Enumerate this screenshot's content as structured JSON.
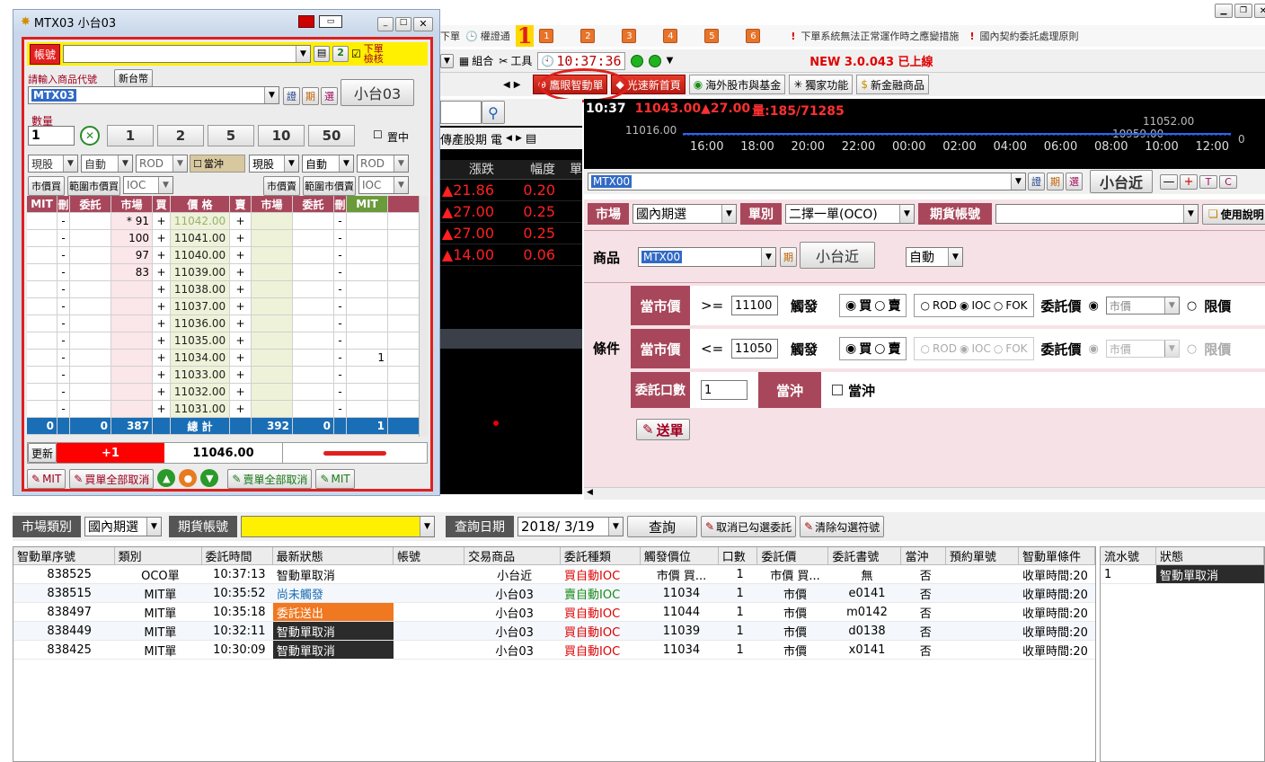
{
  "topbar": {
    "text1": "下單",
    "text2": "權證通",
    "marker": "1",
    "nums": [
      "1",
      "2",
      "3",
      "4",
      "5",
      "6"
    ],
    "notice1": "下單系統無法正常運作時之應變措施",
    "notice2": "國內契約委託處理原則"
  },
  "toolbar2": {
    "combo": "組合",
    "tools": "工具",
    "clock": "10:37:36",
    "version": "NEW 3.0.043 已上線"
  },
  "toolbar3": {
    "smart": "鷹眼智動單",
    "fast": "光速新首頁",
    "overseas": "海外股市與基金",
    "exclusive": "獨家功能",
    "newproduct": "新金融商品"
  },
  "quote": {
    "tab1": "傳產股期",
    "tab2": "電",
    "hdr_change": "漲跌",
    "hdr_pct": "幅度",
    "hdr_more": "單",
    "rows": [
      {
        "chg": "▲21.86",
        "pct": "0.20"
      },
      {
        "chg": "▲27.00",
        "pct": "0.25"
      },
      {
        "chg": "▲27.00",
        "pct": "0.25"
      },
      {
        "chg": "▲14.00",
        "pct": "0.06"
      }
    ]
  },
  "chart": {
    "time": "10:37",
    "price": "11043.00▲27.00",
    "vol": "量:185/71285",
    "top": "11052.00",
    "left": "11016.00",
    "mid": "10959.00",
    "right": "0",
    "ticks": [
      "16:00",
      "18:00",
      "20:00",
      "22:00",
      "00:00",
      "02:00",
      "04:00",
      "06:00",
      "08:00",
      "10:00",
      "12:00"
    ]
  },
  "win": {
    "title": "MTX03 小台03",
    "account_label": "帳號",
    "verify": "下單檢核",
    "prompt": "請輸入商品代號",
    "currency": "新台幣",
    "product": "MTX03",
    "btn_cert": "證",
    "btn_period": "期",
    "btn_select": "選",
    "prodname": "小台03",
    "qty_label": "數量",
    "qty": "1",
    "qtys": [
      "1",
      "2",
      "5",
      "10",
      "50"
    ],
    "center": "置中",
    "sel_left": [
      "現股",
      "自動",
      "ROD"
    ],
    "daytrade": "當沖",
    "sel_right": [
      "現股",
      "自動",
      "ROD"
    ],
    "mkt_left": "市價買",
    "range_left": "範圍市價買",
    "ioc_left": "IOC",
    "mkt_right": "市價賣",
    "range_right": "範圍市價賣",
    "ioc_right": "IOC",
    "headers": [
      "MIT",
      "刪",
      "委託",
      "市場",
      "買",
      "價 格",
      "賣",
      "市場",
      "委託",
      "刪",
      "MIT"
    ],
    "rows": [
      {
        "bm": "* 91",
        "price": "11042.00",
        "rmit": ""
      },
      {
        "bm": "100",
        "price": "11041.00",
        "rmit": ""
      },
      {
        "bm": "97",
        "price": "11040.00",
        "rmit": ""
      },
      {
        "bm": "83",
        "price": "11039.00",
        "rmit": ""
      },
      {
        "bm": "",
        "price": "11038.00",
        "rmit": ""
      },
      {
        "bm": "",
        "price": "11037.00",
        "rmit": ""
      },
      {
        "bm": "",
        "price": "11036.00",
        "rmit": ""
      },
      {
        "bm": "",
        "price": "11035.00",
        "rmit": ""
      },
      {
        "bm": "",
        "price": "11034.00",
        "rmit": "1"
      },
      {
        "bm": "",
        "price": "11033.00",
        "rmit": ""
      },
      {
        "bm": "",
        "price": "11032.00",
        "rmit": ""
      },
      {
        "bm": "",
        "price": "11031.00",
        "rmit": ""
      }
    ],
    "dash": "-",
    "plus": "+",
    "total": {
      "mit": "0",
      "order": "0",
      "market": "387",
      "label": "總 計",
      "smarket": "392",
      "sorder": "0",
      "smit": "1"
    },
    "update": "更新",
    "delta": "+1",
    "last": "11046.00",
    "bottom": [
      "MIT",
      "買單全部取消",
      "賣單全部取消",
      "MIT"
    ]
  },
  "right": {
    "product": "MTX00",
    "btn_cert": "證",
    "btn_period": "期",
    "btn_select": "選",
    "prodname": "小台近",
    "side_btns": [
      "—",
      "+",
      "T",
      "C"
    ],
    "market_label": "市場",
    "market": "國內期選",
    "type_label": "單別",
    "type": "二擇一單(OCO)",
    "acct_label": "期貨帳號",
    "manual": "使用說明",
    "prod_label": "商品",
    "prod_code": "MTX00",
    "prod_period": "期",
    "prod_name": "小台近",
    "auto": "自動",
    "cond_label": "條件",
    "c1_label": "當市價",
    "c1_op": ">=",
    "c1_val": "11100",
    "trigger": "觸發",
    "buy": "買",
    "sell": "賣",
    "rod": "ROD",
    "ioc": "IOC",
    "fok": "FOK",
    "order_price": "委託價",
    "mkt": "市價",
    "limit": "限價",
    "c2_label": "當市價",
    "c2_op": "<=",
    "c2_val": "11050",
    "qty_label": "委託口數",
    "qty": "1",
    "daytrade_label": "當沖",
    "daytrade": "當沖",
    "send": "送單"
  },
  "query": {
    "market_label": "市場類別",
    "market": "國內期選",
    "acct_label": "期貨帳號",
    "date_label": "查詢日期",
    "date": "2018/  3/19",
    "btn_query": "查詢",
    "btn_cancel": "取消已勾選委託",
    "btn_clear": "清除勾選符號"
  },
  "table": {
    "headers": [
      "智動單序號",
      "類別",
      "委託時間",
      "最新狀態",
      "帳號",
      "交易商品",
      "委託種類",
      "觸發價位",
      "口數",
      "委託價",
      "委託書號",
      "當沖",
      "預約單號",
      "智動單條件"
    ],
    "rows": [
      {
        "id": "838525",
        "type": "OCO單",
        "time": "10:37:13",
        "status": "智動單取消",
        "acct": "",
        "prod": "小台近",
        "kind": "買自動IOC",
        "trig": "市價 買...",
        "qty": "1",
        "price": "市價 買...",
        "ref": "無",
        "dt": "否",
        "res": "",
        "cond": "收單時間:20"
      },
      {
        "id": "838515",
        "type": "MIT單",
        "time": "10:35:52",
        "status": "尚未觸發",
        "acct": "",
        "prod": "小台03",
        "kind": "賣自動IOC",
        "trig": "11034",
        "qty": "1",
        "price": "市價",
        "ref": "e0141",
        "dt": "否",
        "res": "",
        "cond": "收單時間:20"
      },
      {
        "id": "838497",
        "type": "MIT單",
        "time": "10:35:18",
        "status": "委託送出",
        "acct": "",
        "prod": "小台03",
        "kind": "買自動IOC",
        "trig": "11044",
        "qty": "1",
        "price": "市價",
        "ref": "m0142",
        "dt": "否",
        "res": "",
        "cond": "收單時間:20"
      },
      {
        "id": "838449",
        "type": "MIT單",
        "time": "10:32:11",
        "status": "智動單取消",
        "acct": "",
        "prod": "小台03",
        "kind": "買自動IOC",
        "trig": "11039",
        "qty": "1",
        "price": "市價",
        "ref": "d0138",
        "dt": "否",
        "res": "",
        "cond": "收單時間:20"
      },
      {
        "id": "838425",
        "type": "MIT單",
        "time": "10:30:09",
        "status": "智動單取消",
        "acct": "",
        "prod": "小台03",
        "kind": "買自動IOC",
        "trig": "11034",
        "qty": "1",
        "price": "市價",
        "ref": "x0141",
        "dt": "否",
        "res": "",
        "cond": "收單時間:20"
      }
    ]
  },
  "side_table": {
    "headers": [
      "流水號",
      "狀態"
    ],
    "rows": [
      {
        "no": "1",
        "status": "智動單取消"
      }
    ]
  }
}
